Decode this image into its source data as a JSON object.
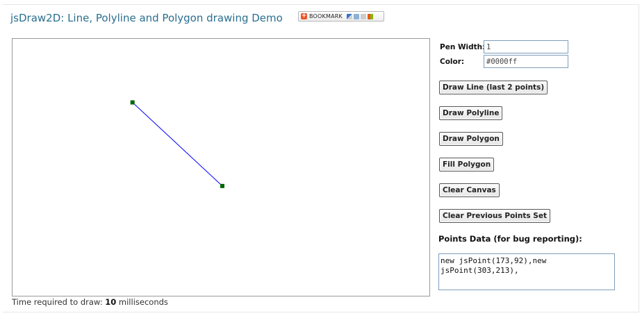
{
  "page": {
    "title": "jsDraw2D: Line, Polyline and Polygon drawing Demo",
    "bookmark_label": "BOOKMARK"
  },
  "form": {
    "pen_width_label": "Pen Width:",
    "pen_width_value": "1",
    "color_label": "Color:",
    "color_value": "#0000ff"
  },
  "buttons": {
    "draw_line": "Draw Line (last 2 points)",
    "draw_polyline": "Draw Polyline",
    "draw_polygon": "Draw Polygon",
    "fill_polygon": "Fill Polygon",
    "clear_canvas": "Clear Canvas",
    "clear_points": "Clear Previous Points Set"
  },
  "points": {
    "label": "Points Data (for bug reporting):",
    "text": "new jsPoint(173,92),new jsPoint(303,213),"
  },
  "canvas": {
    "line_color": "#0000ff",
    "point_color": "#006600",
    "points": [
      [
        173,
        92
      ],
      [
        303,
        213
      ]
    ]
  },
  "timer": {
    "prefix": "Time required to draw: ",
    "value": "10",
    "suffix": " milliseconds"
  },
  "colors": {
    "title": "#2a6f8f",
    "canvas_border": "#999999"
  }
}
